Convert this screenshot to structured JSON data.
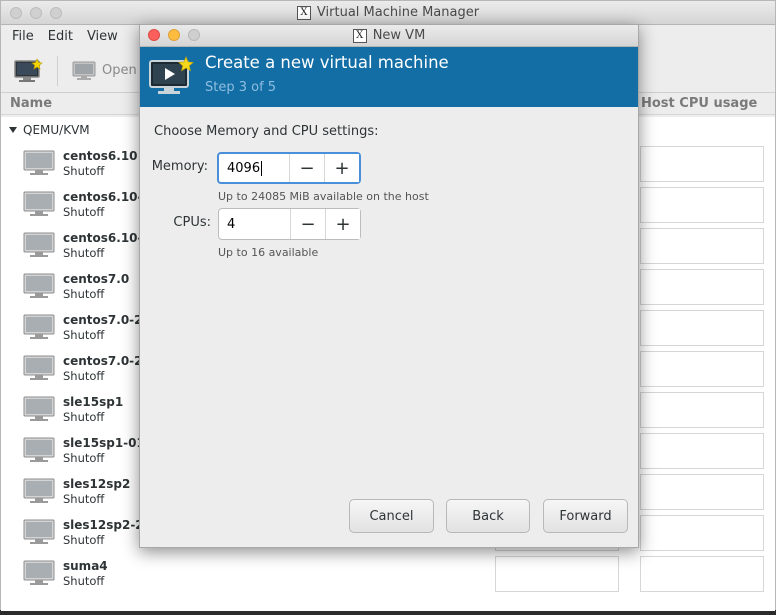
{
  "main_window": {
    "title": "Virtual Machine Manager",
    "menu": [
      "File",
      "Edit",
      "View"
    ],
    "toolbar": {
      "open_label": "Open"
    },
    "columns": {
      "name": "Name",
      "cpu": "Host CPU usage"
    },
    "group": "QEMU/KVM",
    "vms": [
      {
        "name": "centos6.10",
        "state": "Shutoff"
      },
      {
        "name": "centos6.10-",
        "state": "Shutoff"
      },
      {
        "name": "centos6.10-",
        "state": "Shutoff"
      },
      {
        "name": "centos7.0",
        "state": "Shutoff"
      },
      {
        "name": "centos7.0-2",
        "state": "Shutoff"
      },
      {
        "name": "centos7.0-2",
        "state": "Shutoff"
      },
      {
        "name": "sle15sp1",
        "state": "Shutoff"
      },
      {
        "name": "sle15sp1-01",
        "state": "Shutoff"
      },
      {
        "name": "sles12sp2",
        "state": "Shutoff"
      },
      {
        "name": "sles12sp2-2",
        "state": "Shutoff"
      },
      {
        "name": "suma4",
        "state": "Shutoff"
      }
    ]
  },
  "dialog": {
    "title": "New VM",
    "banner_title": "Create a new virtual machine",
    "step": "Step 3 of 5",
    "heading": "Choose Memory and CPU settings:",
    "memory": {
      "label": "Memory:",
      "value": "4096",
      "hint": "Up to 24085 MiB available on the host"
    },
    "cpus": {
      "label": "CPUs:",
      "value": "4",
      "hint": "Up to 16 available"
    },
    "minus": "−",
    "plus": "+",
    "buttons": {
      "cancel": "Cancel",
      "back": "Back",
      "forward": "Forward"
    }
  },
  "colors": {
    "banner": "#136ea5",
    "focus": "#4a90d9"
  }
}
